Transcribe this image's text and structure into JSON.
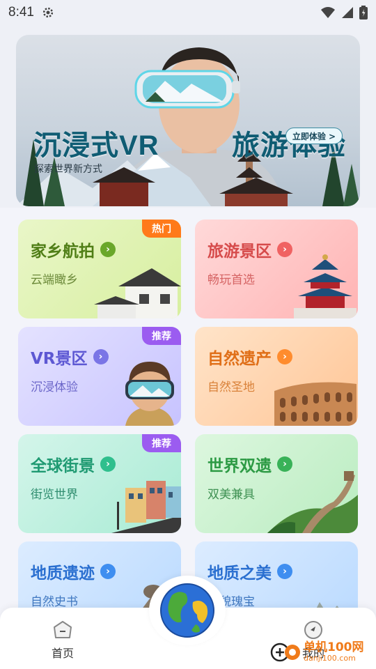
{
  "status_bar": {
    "time": "8:41"
  },
  "banner": {
    "title_left": "沉浸式VR",
    "title_right": "旅游体验",
    "subtitle": "探索世界新方式",
    "cta": "立即体验 >"
  },
  "cards": [
    {
      "title": "家乡航拍",
      "subtitle": "云端瞰乡",
      "tag": "热门"
    },
    {
      "title": "旅游景区",
      "subtitle": "畅玩首选"
    },
    {
      "title": "VR景区",
      "subtitle": "沉浸体验",
      "tag": "推荐"
    },
    {
      "title": "自然遗产",
      "subtitle": "自然圣地"
    },
    {
      "title": "全球街景",
      "subtitle": "街览世界",
      "tag": "推荐"
    },
    {
      "title": "世界双遗",
      "subtitle": "双美兼具"
    },
    {
      "title": "地质遗迹",
      "subtitle": "自然史书"
    },
    {
      "title": "地质之美",
      "subtitle": "地貌瑰宝"
    }
  ],
  "bottom_nav": {
    "home_label": "首页",
    "mine_label": "我的"
  },
  "watermark": {
    "cn": "单机100网",
    "en": "danji100.com"
  }
}
